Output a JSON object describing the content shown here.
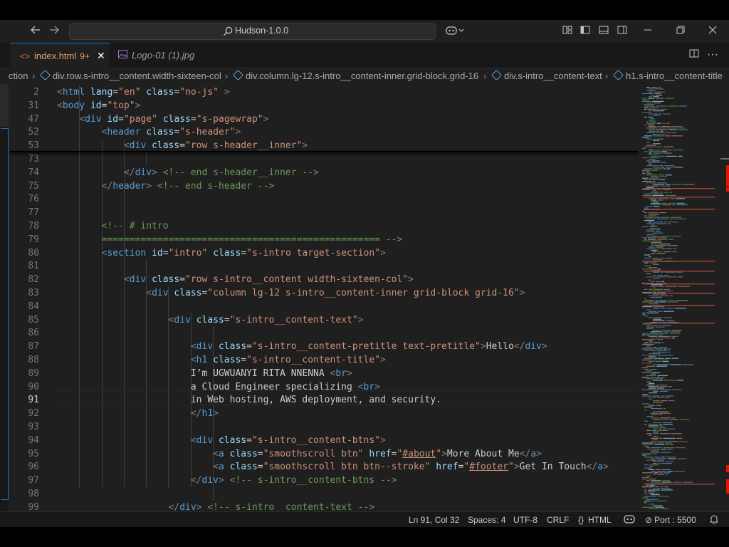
{
  "titlebar": {
    "search_text": "Hudson-1.0.0",
    "icons": [
      "back-arrow-icon",
      "forward-arrow-icon",
      "search-icon",
      "copilot-icon",
      "layout-icon",
      "toggle-sidebar-icon",
      "toggle-panel-icon",
      "toggle-secondary-sidebar-icon",
      "minimize-icon",
      "restore-icon",
      "close-icon"
    ]
  },
  "tabs": [
    {
      "label": "index.html",
      "badge": "9+",
      "active": true
    },
    {
      "label": "Logo-01 (1).jpg",
      "active": false
    }
  ],
  "breadcrumb": [
    "ction",
    "div.row.s-intro__content.width-sixteen-col",
    "div.column.lg-12.s-intro__content-inner.grid-block.grid-16",
    "div.s-intro__content-text",
    "h1.s-intro__content-title"
  ],
  "gutter": [
    "2",
    "31",
    "47",
    "52",
    "53",
    "73",
    "74",
    "75",
    "76",
    "77",
    "78",
    "79",
    "80",
    "81",
    "82",
    "83",
    "84",
    "85",
    "86",
    "87",
    "88",
    "89",
    "90",
    "91",
    "92",
    "93",
    "94",
    "95",
    "96",
    "97",
    "98",
    "99"
  ],
  "current_line": "91",
  "code": [
    "<html lang=\"en\" class=\"no-js\" >",
    "<body id=\"top\">",
    "    <div id=\"page\" class=\"s-pagewrap\">",
    "        <header class=\"s-header\">",
    "            <div class=\"row s-header__inner\">",
    "",
    "            </div> <!-- end s-header__inner -->",
    "        </header> <!-- end s-header -->",
    "",
    "",
    "        <!-- # intro",
    "        ================================================== -->",
    "        <section id=\"intro\" class=\"s-intro target-section\">",
    "",
    "            <div class=\"row s-intro__content width-sixteen-col\">",
    "                <div class=\"column lg-12 s-intro__content-inner grid-block grid-16\">",
    "",
    "                    <div class=\"s-intro__content-text\">",
    "",
    "                        <div class=\"s-intro__content-pretitle text-pretitle\">Hello</div>",
    "                        <h1 class=\"s-intro__content-title\">",
    "                        I’m UGWUANYI RITA NNENNA <br>",
    "                        a Cloud Engineer specializing <br>",
    "                        in Web hosting, AWS deployment, and security.",
    "                        </h1>",
    "",
    "                        <div class=\"s-intro__content-btns\">",
    "                            <a class=\"smoothscroll btn\" href=\"#about\">More About Me</a>",
    "                            <a class=\"smoothscroll btn btn--stroke\" href=\"#footer\">Get In Touch</a>",
    "                        </div> <!-- s-intro__content-btns -->",
    "",
    "                    </div> <!-- s-intro__content-text -->"
  ],
  "status": {
    "position": "Ln 91, Col 32",
    "spaces": "Spaces: 4",
    "encoding": "UTF-8",
    "eol": "CRLF",
    "language": "HTML",
    "port": "Port : 5500"
  },
  "colors": {
    "accent": "#0078d4",
    "tag": "#569cd6",
    "attr": "#9cdcfe",
    "string": "#ce9178",
    "comment": "#6a9955",
    "badge": "#e2a16f"
  }
}
